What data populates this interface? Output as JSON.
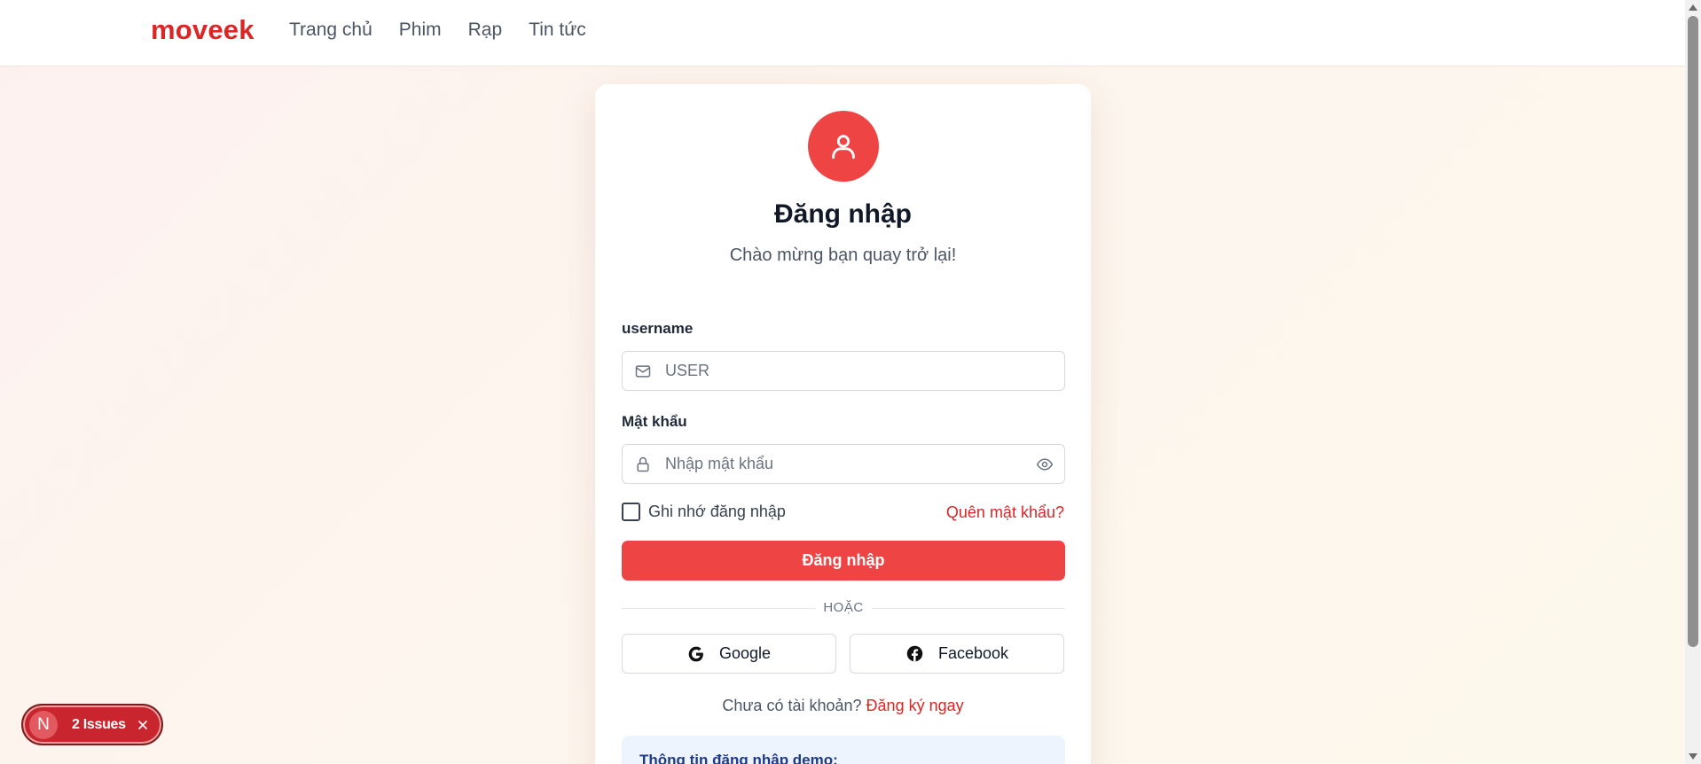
{
  "nav": {
    "logo": "moveek",
    "links": [
      "Trang chủ",
      "Phim",
      "Rạp",
      "Tin tức"
    ]
  },
  "login": {
    "title": "Đăng nhập",
    "subtitle": "Chào mừng bạn quay trở lại!",
    "username_label": "username",
    "username_placeholder": "USER",
    "password_label": "Mật khẩu",
    "password_placeholder": "Nhập mật khẩu",
    "remember_label": "Ghi nhớ đăng nhập",
    "remember_checked": false,
    "forgot_label": "Quên mật khẩu?",
    "submit_label": "Đăng nhập",
    "divider_text": "HOẶC",
    "google_label": "Google",
    "facebook_label": "Facebook",
    "signup_prompt": "Chưa có tài khoản?",
    "signup_link": "Đăng ký ngay",
    "demo_title": "Thông tin đăng nhập demo:"
  },
  "dev_overlay": {
    "badge_letter": "N",
    "issues_label": "2 Issues"
  },
  "colors": {
    "brand": "#dc2626",
    "primary_button": "#ef4444",
    "demo_box": "#eef4fd"
  },
  "icons": {
    "user": "user-icon",
    "mail": "mail-icon",
    "lock": "lock-icon",
    "eye": "eye-icon",
    "google": "google-icon",
    "facebook": "facebook-icon",
    "close": "close-icon"
  }
}
